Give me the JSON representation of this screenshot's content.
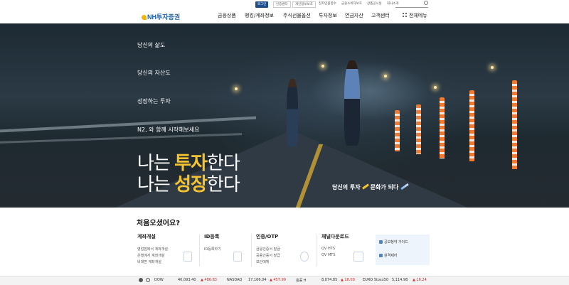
{
  "utility": {
    "login": "로그인",
    "links": [
      "인증센터",
      "개인정보보호",
      "전자민원접수",
      "금융소비자보호",
      "상품공시실",
      "회사소개"
    ]
  },
  "brand": {
    "logo": "NH투자증권"
  },
  "gnb": [
    "금융상품",
    "뱅킹/계좌정보",
    "주식선물옵션",
    "투자정보",
    "연금자산",
    "고객센터"
  ],
  "all_menu": "전체메뉴",
  "hero": {
    "lines": [
      "당신의 삶도",
      "당신의 자산도",
      "성장하는 투자",
      "N2, 와 함께 시작해보세요"
    ],
    "slogan1_a": "나는 ",
    "slogan1_b": "투자",
    "slogan1_c": "한다",
    "slogan2_a": "나는 ",
    "slogan2_b": "성장",
    "slogan2_c": "한다",
    "tag_a": "당신의 투자",
    "tag_b": "문화가 되다"
  },
  "welcome": {
    "title": "처음오셨어요?",
    "columns": [
      {
        "title": "계좌개설",
        "items": [
          "영업점에서 계좌개설",
          "은행에서 계좌개설",
          "비대면 계좌개설"
        ]
      },
      {
        "title": "ID등록",
        "items": [
          "ID등록하기"
        ]
      },
      {
        "title": "인증/OTP",
        "items": [
          "금융인증서 발급",
          "공동인증서 발급",
          "보안매체"
        ]
      },
      {
        "title": "채널다운로드",
        "items": [
          "QV HTS",
          "QV MTS"
        ]
      }
    ],
    "guide": [
      "공모청약 가이드",
      "원격제어"
    ]
  },
  "ticker": [
    {
      "name": "DOW",
      "value": "40,093.40",
      "change": "▲ 486.83"
    },
    {
      "name": "NASDAQ",
      "value": "17,166.04",
      "change": "▲ 457.99"
    },
    {
      "name": "홍콩 H",
      "value": "8,074.85",
      "change": "▲ 18.00"
    },
    {
      "name": "EURO Stoxx50",
      "value": "5,114.98",
      "change": "▲ 16.24"
    }
  ],
  "colors": {
    "brand_blue": "#1b5fae",
    "accent_yellow": "#f4c430",
    "up_red": "#d52b2b"
  }
}
